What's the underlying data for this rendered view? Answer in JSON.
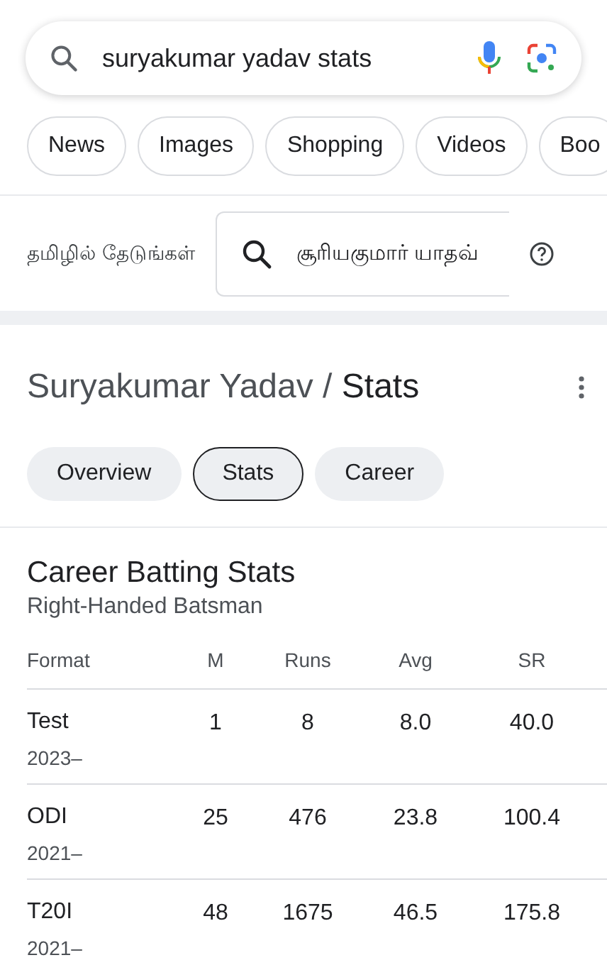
{
  "search": {
    "value": "suryakumar yadav stats"
  },
  "chips": [
    {
      "label": "News"
    },
    {
      "label": "Images"
    },
    {
      "label": "Shopping"
    },
    {
      "label": "Videos"
    },
    {
      "label": "Boo"
    }
  ],
  "translate": {
    "label": "தமிழில் தேடுங்கள்",
    "query": "சூரியகுமார் யாதவ்"
  },
  "header": {
    "title": "Suryakumar Yadav / **Stats**"
  },
  "tabs": [
    {
      "label": "Overview",
      "selected": false
    },
    {
      "label": "Stats",
      "selected": true
    },
    {
      "label": "Career",
      "selected": false
    }
  ],
  "stats": {
    "title": "Career Batting Stats",
    "subtitle": "Right-Handed Batsman",
    "columns": [
      "Format",
      "M",
      "Runs",
      "Avg",
      "SR"
    ],
    "rows": [
      {
        "cells": [
          "Test",
          "1",
          "8",
          "8.0",
          "40.0"
        ],
        "years": "2023–"
      },
      {
        "cells": [
          "ODI",
          "25",
          "476",
          "23.8",
          "100.4"
        ],
        "years": "2021–"
      },
      {
        "cells": [
          "T20I",
          "48",
          "1675",
          "46.5",
          "175.8"
        ],
        "years": "2021–"
      }
    ]
  }
}
